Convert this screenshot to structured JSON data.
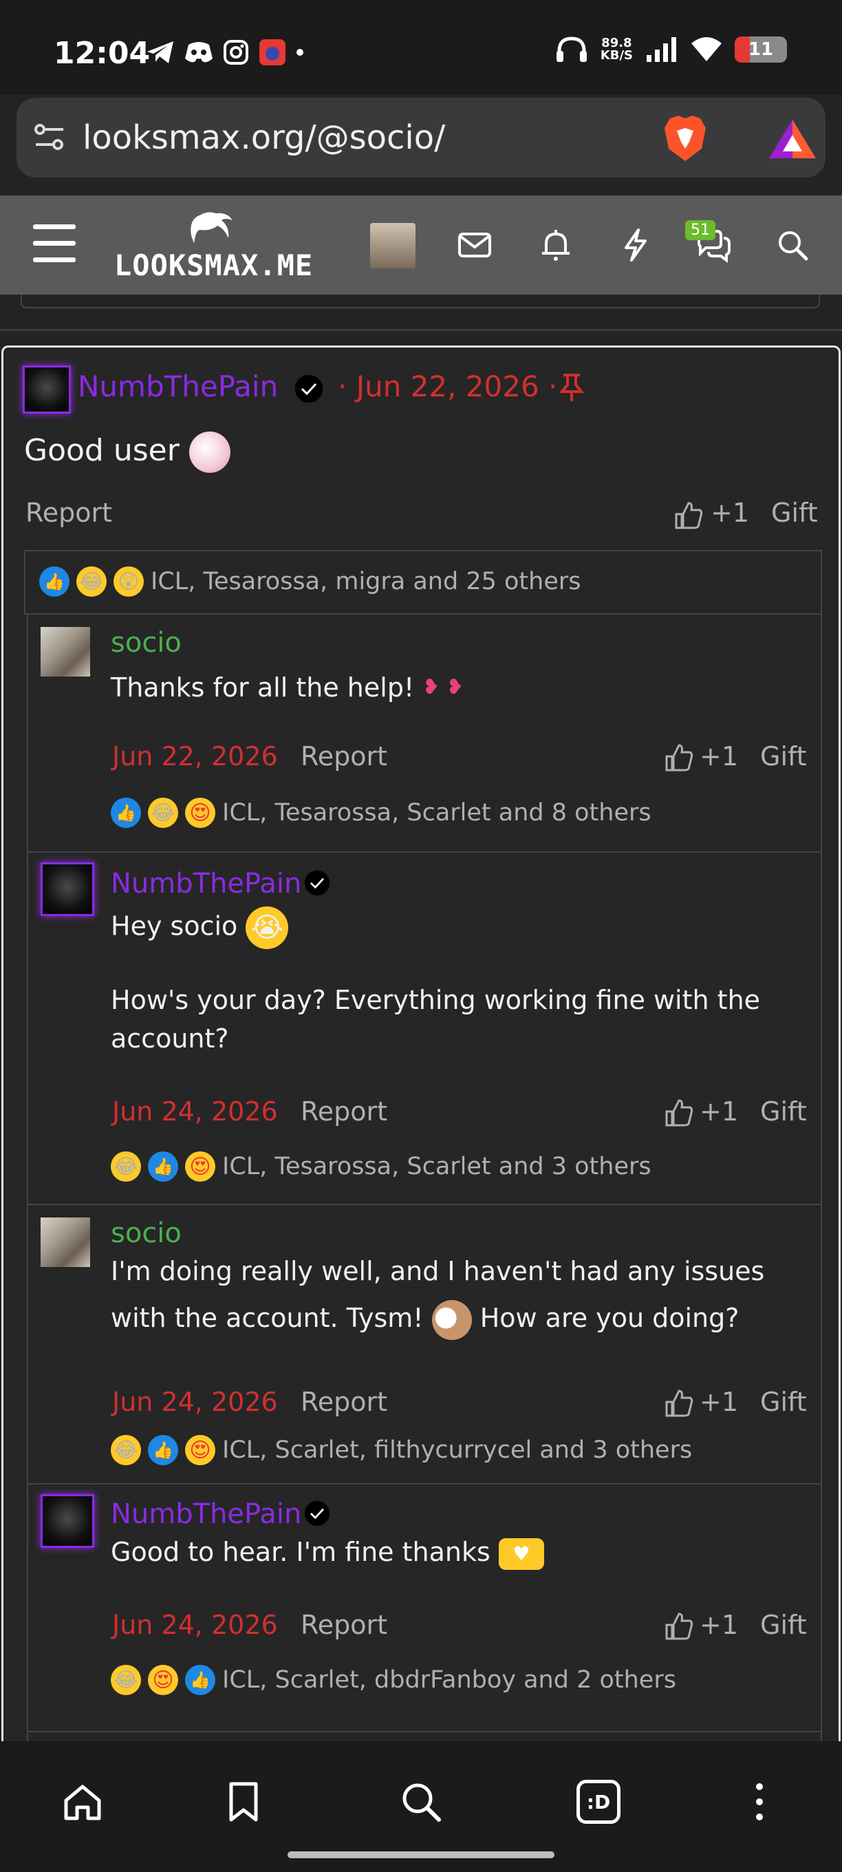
{
  "status_bar": {
    "time": "12:04",
    "speed_value": "89.8",
    "speed_unit": "KB/S",
    "battery": "11"
  },
  "browser": {
    "url": "looksmax.org/@socio/"
  },
  "site_nav": {
    "logo_text": "LOOKSMAX.ME",
    "messages_badge": "51"
  },
  "post": {
    "author": "NumbThePain",
    "date_separator": "·",
    "date": "Jun 22, 2026",
    "content": "Good user",
    "report_label": "Report",
    "like_label": "+1",
    "gift_label": "Gift",
    "reactions_text": "ICL, Tesarossa, migra and 25 others"
  },
  "replies": [
    {
      "author": "socio",
      "text": "Thanks for all the help!",
      "date": "Jun 22, 2026",
      "report": "Report",
      "like": "+1",
      "gift": "Gift",
      "reactions_text": "ICL, Tesarossa, Scarlet and 8 others"
    },
    {
      "author": "NumbThePain",
      "text": "Hey socio",
      "text2": "How's your day? Everything working fine with the account?",
      "date": "Jun 24, 2026",
      "report": "Report",
      "like": "+1",
      "gift": "Gift",
      "reactions_text": "ICL, Tesarossa, Scarlet and 3 others"
    },
    {
      "author": "socio",
      "text": "I'm doing really well, and I haven't had any issues",
      "text2": "with the account. Tysm!",
      "text3": "How are you doing?",
      "date": "Jun 24, 2026",
      "report": "Report",
      "like": "+1",
      "gift": "Gift",
      "reactions_text": "ICL, Scarlet, filthycurrycel and 3 others"
    },
    {
      "author": "NumbThePain",
      "text": "Good to hear. I'm fine thanks",
      "date": "Jun 24, 2026",
      "report": "Report",
      "like": "+1",
      "gift": "Gift",
      "reactions_text": "ICL, Scarlet, dbdrFanboy and 2 others"
    }
  ],
  "bottom_nav": {
    "icons": [
      "home-icon",
      "bookmark-icon",
      "search-icon",
      "leo-ai-icon",
      "more-icon"
    ],
    "leo_label": ":D"
  },
  "colors": {
    "username_purple": "#8a2be2",
    "username_green": "#4caf50",
    "date_red": "#d32f2f",
    "background": "#232323"
  }
}
